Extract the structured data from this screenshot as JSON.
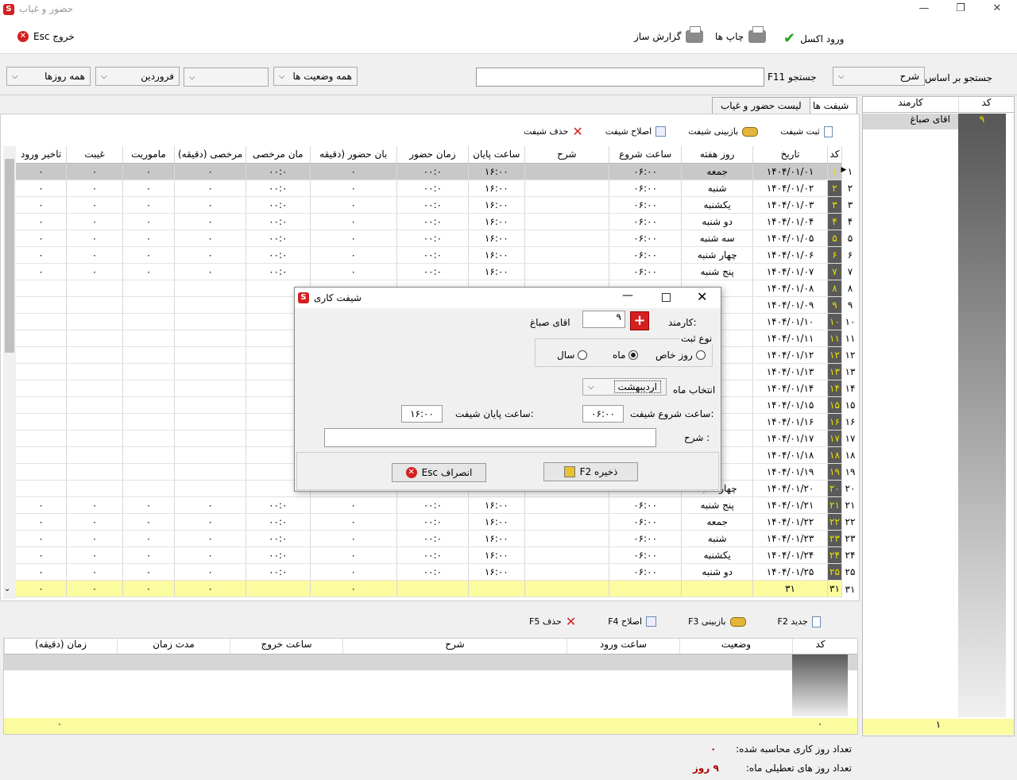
{
  "window": {
    "title": "حضور و غیاب",
    "minimize": "—",
    "restore": "❐",
    "close": "✕"
  },
  "toolbar": {
    "excel_label": "ورود اکسل",
    "print_label": "چاپ ها",
    "report_label": "گزارش ساز",
    "exit_label": "خروج Esc"
  },
  "filters": {
    "search_by_label": "جستجو بر اساس",
    "search_by_value": "شرح",
    "search_label": "F11 جستجو",
    "search_value": "",
    "status_value": "همه وضعیت ها",
    "blank_value": "",
    "month_value": "فروردین",
    "days_value": "همه روزها"
  },
  "tabs": {
    "shifts": "شیفت ها",
    "attendance_list": "لیست حضور و غیاب"
  },
  "shift_actions": {
    "save": "ثبت شیفت",
    "review": "بازبینی شیفت",
    "edit": "اصلاح شیفت",
    "delete": "حذف شیفت"
  },
  "grid": {
    "columns": [
      "کد",
      "تاریخ",
      "روز هفته",
      "ساعت شروع",
      "شرح",
      "ساعت پایان",
      "زمان حضور",
      "بان حضور (دقیقه",
      "مان مرخصی",
      "مرخصی (دقیقه)",
      "ماموریت",
      "غیبت",
      "تاخیر ورود"
    ],
    "rows": [
      [
        "۱",
        "۱۴۰۴/۰۱/۰۱",
        "جمعه",
        "۰۶:۰۰",
        "",
        "۱۶:۰۰",
        "۰۰:۰",
        "۰",
        "۰۰:۰",
        "۰",
        "۰",
        "۰",
        "۰"
      ],
      [
        "۲",
        "۱۴۰۴/۰۱/۰۲",
        "شنبه",
        "۰۶:۰۰",
        "",
        "۱۶:۰۰",
        "۰۰:۰",
        "۰",
        "۰۰:۰",
        "۰",
        "۰",
        "۰",
        "۰"
      ],
      [
        "۳",
        "۱۴۰۴/۰۱/۰۳",
        "یکشنبه",
        "۰۶:۰۰",
        "",
        "۱۶:۰۰",
        "۰۰:۰",
        "۰",
        "۰۰:۰",
        "۰",
        "۰",
        "۰",
        "۰"
      ],
      [
        "۴",
        "۱۴۰۴/۰۱/۰۴",
        "دو شنبه",
        "۰۶:۰۰",
        "",
        "۱۶:۰۰",
        "۰۰:۰",
        "۰",
        "۰۰:۰",
        "۰",
        "۰",
        "۰",
        "۰"
      ],
      [
        "۵",
        "۱۴۰۴/۰۱/۰۵",
        "سه شنبه",
        "۰۶:۰۰",
        "",
        "۱۶:۰۰",
        "۰۰:۰",
        "۰",
        "۰۰:۰",
        "۰",
        "۰",
        "۰",
        "۰"
      ],
      [
        "۶",
        "۱۴۰۴/۰۱/۰۶",
        "چهار شنبه",
        "۰۶:۰۰",
        "",
        "۱۶:۰۰",
        "۰۰:۰",
        "۰",
        "۰۰:۰",
        "۰",
        "۰",
        "۰",
        "۰"
      ],
      [
        "۷",
        "۱۴۰۴/۰۱/۰۷",
        "پنج شنبه",
        "۰۶:۰۰",
        "",
        "۱۶:۰۰",
        "۰۰:۰",
        "۰",
        "۰۰:۰",
        "۰",
        "۰",
        "۰",
        "۰"
      ],
      [
        "۸",
        "۱۴۰۴/۰۱/۰۸",
        "",
        "",
        "",
        "",
        "",
        "",
        "",
        "",
        "",
        "",
        ""
      ],
      [
        "۹",
        "۱۴۰۴/۰۱/۰۹",
        "",
        "",
        "",
        "",
        "",
        "",
        "",
        "",
        "",
        "",
        ""
      ],
      [
        "۱۰",
        "۱۴۰۴/۰۱/۱۰",
        "",
        "",
        "",
        "",
        "",
        "",
        "",
        "",
        "",
        "",
        ""
      ],
      [
        "۱۱",
        "۱۴۰۴/۰۱/۱۱",
        "",
        "",
        "",
        "",
        "",
        "",
        "",
        "",
        "",
        "",
        ""
      ],
      [
        "۱۲",
        "۱۴۰۴/۰۱/۱۲",
        "",
        "",
        "",
        "",
        "",
        "",
        "",
        "",
        "",
        "",
        ""
      ],
      [
        "۱۳",
        "۱۴۰۴/۰۱/۱۳",
        "",
        "",
        "",
        "",
        "",
        "",
        "",
        "",
        "",
        "",
        ""
      ],
      [
        "۱۴",
        "۱۴۰۴/۰۱/۱۴",
        "",
        "",
        "",
        "",
        "",
        "",
        "",
        "",
        "",
        "",
        ""
      ],
      [
        "۱۵",
        "۱۴۰۴/۰۱/۱۵",
        "",
        "",
        "",
        "",
        "",
        "",
        "",
        "",
        "",
        "",
        ""
      ],
      [
        "۱۶",
        "۱۴۰۴/۰۱/۱۶",
        "",
        "",
        "",
        "",
        "",
        "",
        "",
        "",
        "",
        "",
        ""
      ],
      [
        "۱۷",
        "۱۴۰۴/۰۱/۱۷",
        "",
        "",
        "",
        "",
        "",
        "",
        "",
        "",
        "",
        "",
        ""
      ],
      [
        "۱۸",
        "۱۴۰۴/۰۱/۱۸",
        "",
        "",
        "",
        "",
        "",
        "",
        "",
        "",
        "",
        "",
        ""
      ],
      [
        "۱۹",
        "۱۴۰۴/۰۱/۱۹",
        "",
        "",
        "",
        "",
        "",
        "",
        "",
        "",
        "",
        "",
        ""
      ],
      [
        "۲۰",
        "۱۴۰۴/۰۱/۲۰",
        "چهار شنبه",
        "",
        "",
        "",
        "",
        "",
        "",
        "",
        "",
        "",
        ""
      ],
      [
        "۲۱",
        "۱۴۰۴/۰۱/۲۱",
        "پنج شنبه",
        "۰۶:۰۰",
        "",
        "۱۶:۰۰",
        "۰۰:۰",
        "۰",
        "۰۰:۰",
        "۰",
        "۰",
        "۰",
        "۰"
      ],
      [
        "۲۲",
        "۱۴۰۴/۰۱/۲۲",
        "جمعه",
        "۰۶:۰۰",
        "",
        "۱۶:۰۰",
        "۰۰:۰",
        "۰",
        "۰۰:۰",
        "۰",
        "۰",
        "۰",
        "۰"
      ],
      [
        "۲۳",
        "۱۴۰۴/۰۱/۲۳",
        "شنبه",
        "۰۶:۰۰",
        "",
        "۱۶:۰۰",
        "۰۰:۰",
        "۰",
        "۰۰:۰",
        "۰",
        "۰",
        "۰",
        "۰"
      ],
      [
        "۲۴",
        "۱۴۰۴/۰۱/۲۴",
        "یکشنبه",
        "۰۶:۰۰",
        "",
        "۱۶:۰۰",
        "۰۰:۰",
        "۰",
        "۰۰:۰",
        "۰",
        "۰",
        "۰",
        "۰"
      ],
      [
        "۲۵",
        "۱۴۰۴/۰۱/۲۵",
        "دو شنبه",
        "۰۶:۰۰",
        "",
        "۱۶:۰۰",
        "۰۰:۰",
        "۰",
        "۰۰:۰",
        "۰",
        "۰",
        "۰",
        "۰"
      ]
    ],
    "row_numbers": [
      "۱",
      "۲",
      "۳",
      "۴",
      "۵",
      "۶",
      "۷",
      "۸",
      "۹",
      "۱۰",
      "۱۱",
      "۱۲",
      "۱۳",
      "۱۴",
      "۱۵",
      "۱۶",
      "۱۷",
      "۱۸",
      "۱۹",
      "۲۰",
      "۲۱",
      "۲۲",
      "۲۳",
      "۲۴",
      "۲۵"
    ],
    "summary": [
      "۳۱",
      "۳۱",
      "",
      "",
      "",
      "",
      "",
      "۰",
      "",
      "۰",
      "۰",
      "۰",
      "۰"
    ],
    "summary_rownum": "۳۱"
  },
  "bottom_actions": {
    "new": "جدید F2",
    "review": "بازبینی F3",
    "edit": "اصلاح F4",
    "delete": "حذف F5"
  },
  "grid2": {
    "columns": [
      "کد",
      "وضعیت",
      "ساعت ورود",
      "شرح",
      "ساعت خروج",
      "مدت زمان",
      "زمان (دقیقه)"
    ],
    "summary_code": "۰",
    "summary_minutes": "۰"
  },
  "right_panel": {
    "col_code": "کد",
    "col_employee": "کارمند",
    "row_code": "۹",
    "row_name": "اقای صباغ",
    "summary": "۱"
  },
  "status": {
    "worked_days_label": "تعداد روز کاری محاسبه شده:",
    "worked_days_value": "۰",
    "holidays_label": "تعداد روز های تعطیلی ماه:",
    "holidays_value": "۹ روز"
  },
  "dialog": {
    "title": "شیفت کاری",
    "employee_label": "کارمند:",
    "employee_code": "۹",
    "employee_name": "اقای صباغ",
    "reg_type_label": "نوع ثبت",
    "opt_specific_day": "روز خاص",
    "opt_month": "ماه",
    "opt_year": "سال",
    "month_select_label": "انتخاب ماه",
    "month_select_value": "اردیبهشت",
    "start_label": "ساعت شروع شیفت:",
    "start_value": "۰۶:۰۰",
    "end_label": "ساعت پایان شیفت:",
    "end_value": "۱۶:۰۰",
    "desc_label": "شرح :",
    "desc_value": "",
    "save_label": "ذخیره F2",
    "cancel_label": "انصراف Esc"
  }
}
